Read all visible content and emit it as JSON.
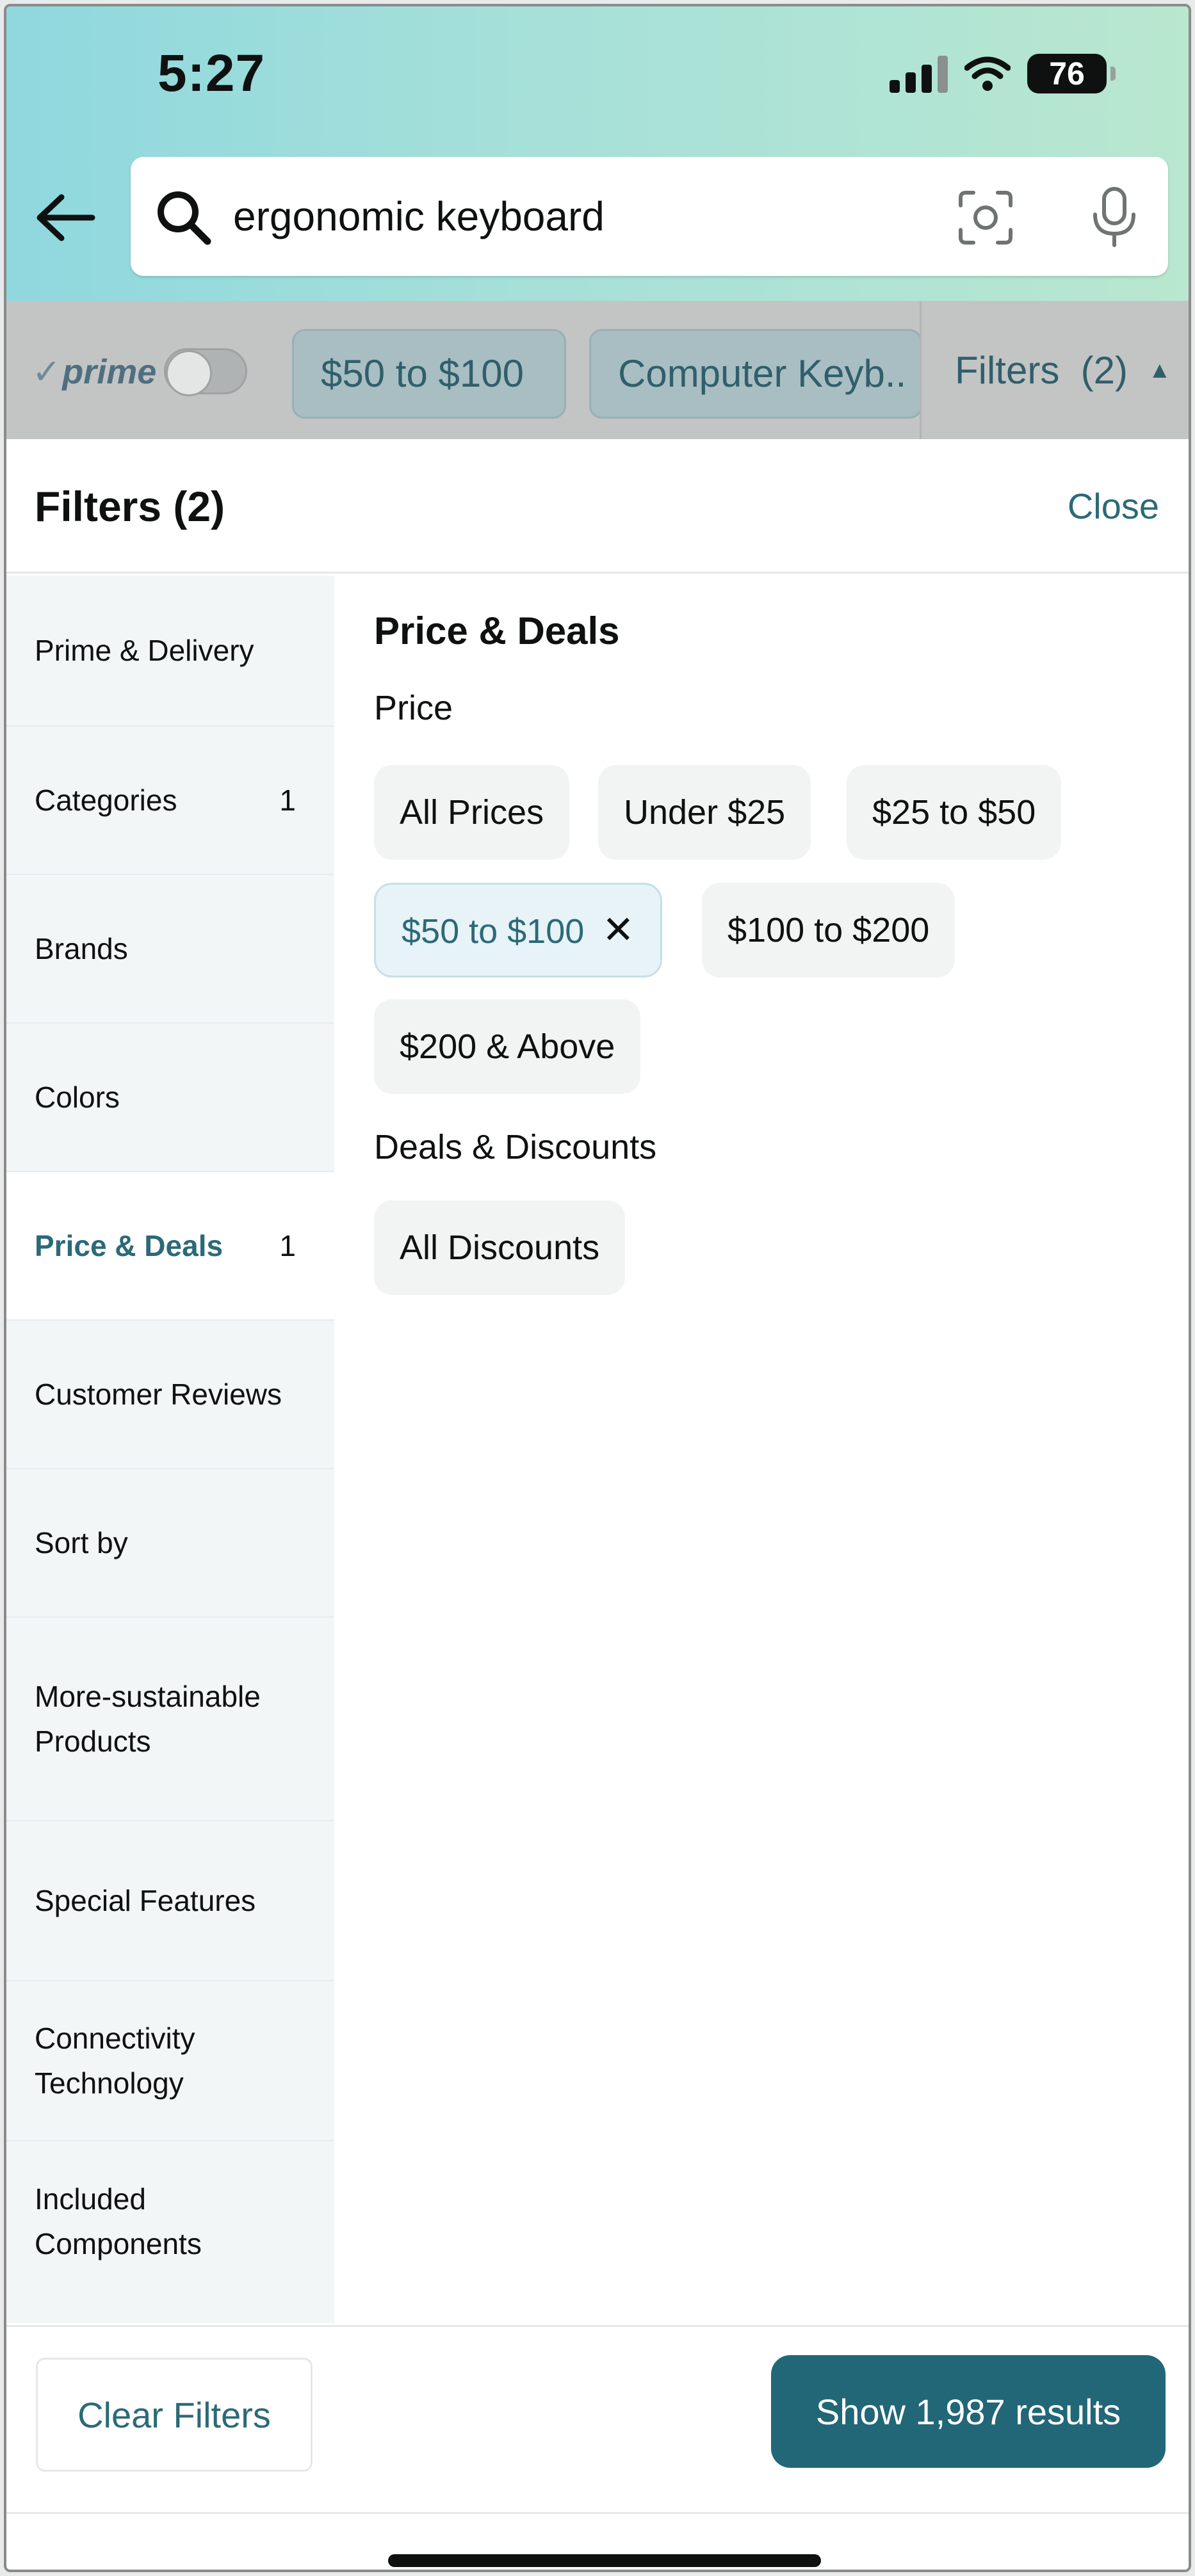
{
  "status_bar": {
    "time": "5:27",
    "battery": "76"
  },
  "search": {
    "query": "ergonomic keyboard"
  },
  "refinements": {
    "prime_label": "prime",
    "chips": [
      "$50 to $100",
      "Computer Keyb.."
    ],
    "filters_label": "Filters  (2)"
  },
  "sheet": {
    "title": "Filters (2)",
    "close_label": "Close"
  },
  "nav": {
    "items": [
      {
        "label": "Prime & Delivery",
        "count": ""
      },
      {
        "label": "Categories",
        "count": "1"
      },
      {
        "label": "Brands",
        "count": ""
      },
      {
        "label": "Colors",
        "count": ""
      },
      {
        "label": "Price & Deals",
        "count": "1",
        "active": true
      },
      {
        "label": "Customer Reviews",
        "count": ""
      },
      {
        "label": "Sort by",
        "count": ""
      },
      {
        "label": "More-sustainable Products",
        "count": ""
      },
      {
        "label": "Special Features",
        "count": ""
      },
      {
        "label": "Connectivity Technology",
        "count": ""
      },
      {
        "label": "Included Components",
        "count": ""
      }
    ]
  },
  "price_deals": {
    "title": "Price & Deals",
    "price_label": "Price",
    "price_options": [
      "All Prices",
      "Under $25",
      "$25 to $50",
      "$50 to $100",
      "$100 to $200",
      "$200 & Above"
    ],
    "selected_price": "$50 to $100",
    "deals_label": "Deals & Discounts",
    "deals_options": [
      "All Discounts"
    ]
  },
  "footer": {
    "clear_label": "Clear Filters",
    "show_label": "Show 1,987 results"
  },
  "colors": {
    "accent": "#2b6a78",
    "button": "#216777"
  }
}
